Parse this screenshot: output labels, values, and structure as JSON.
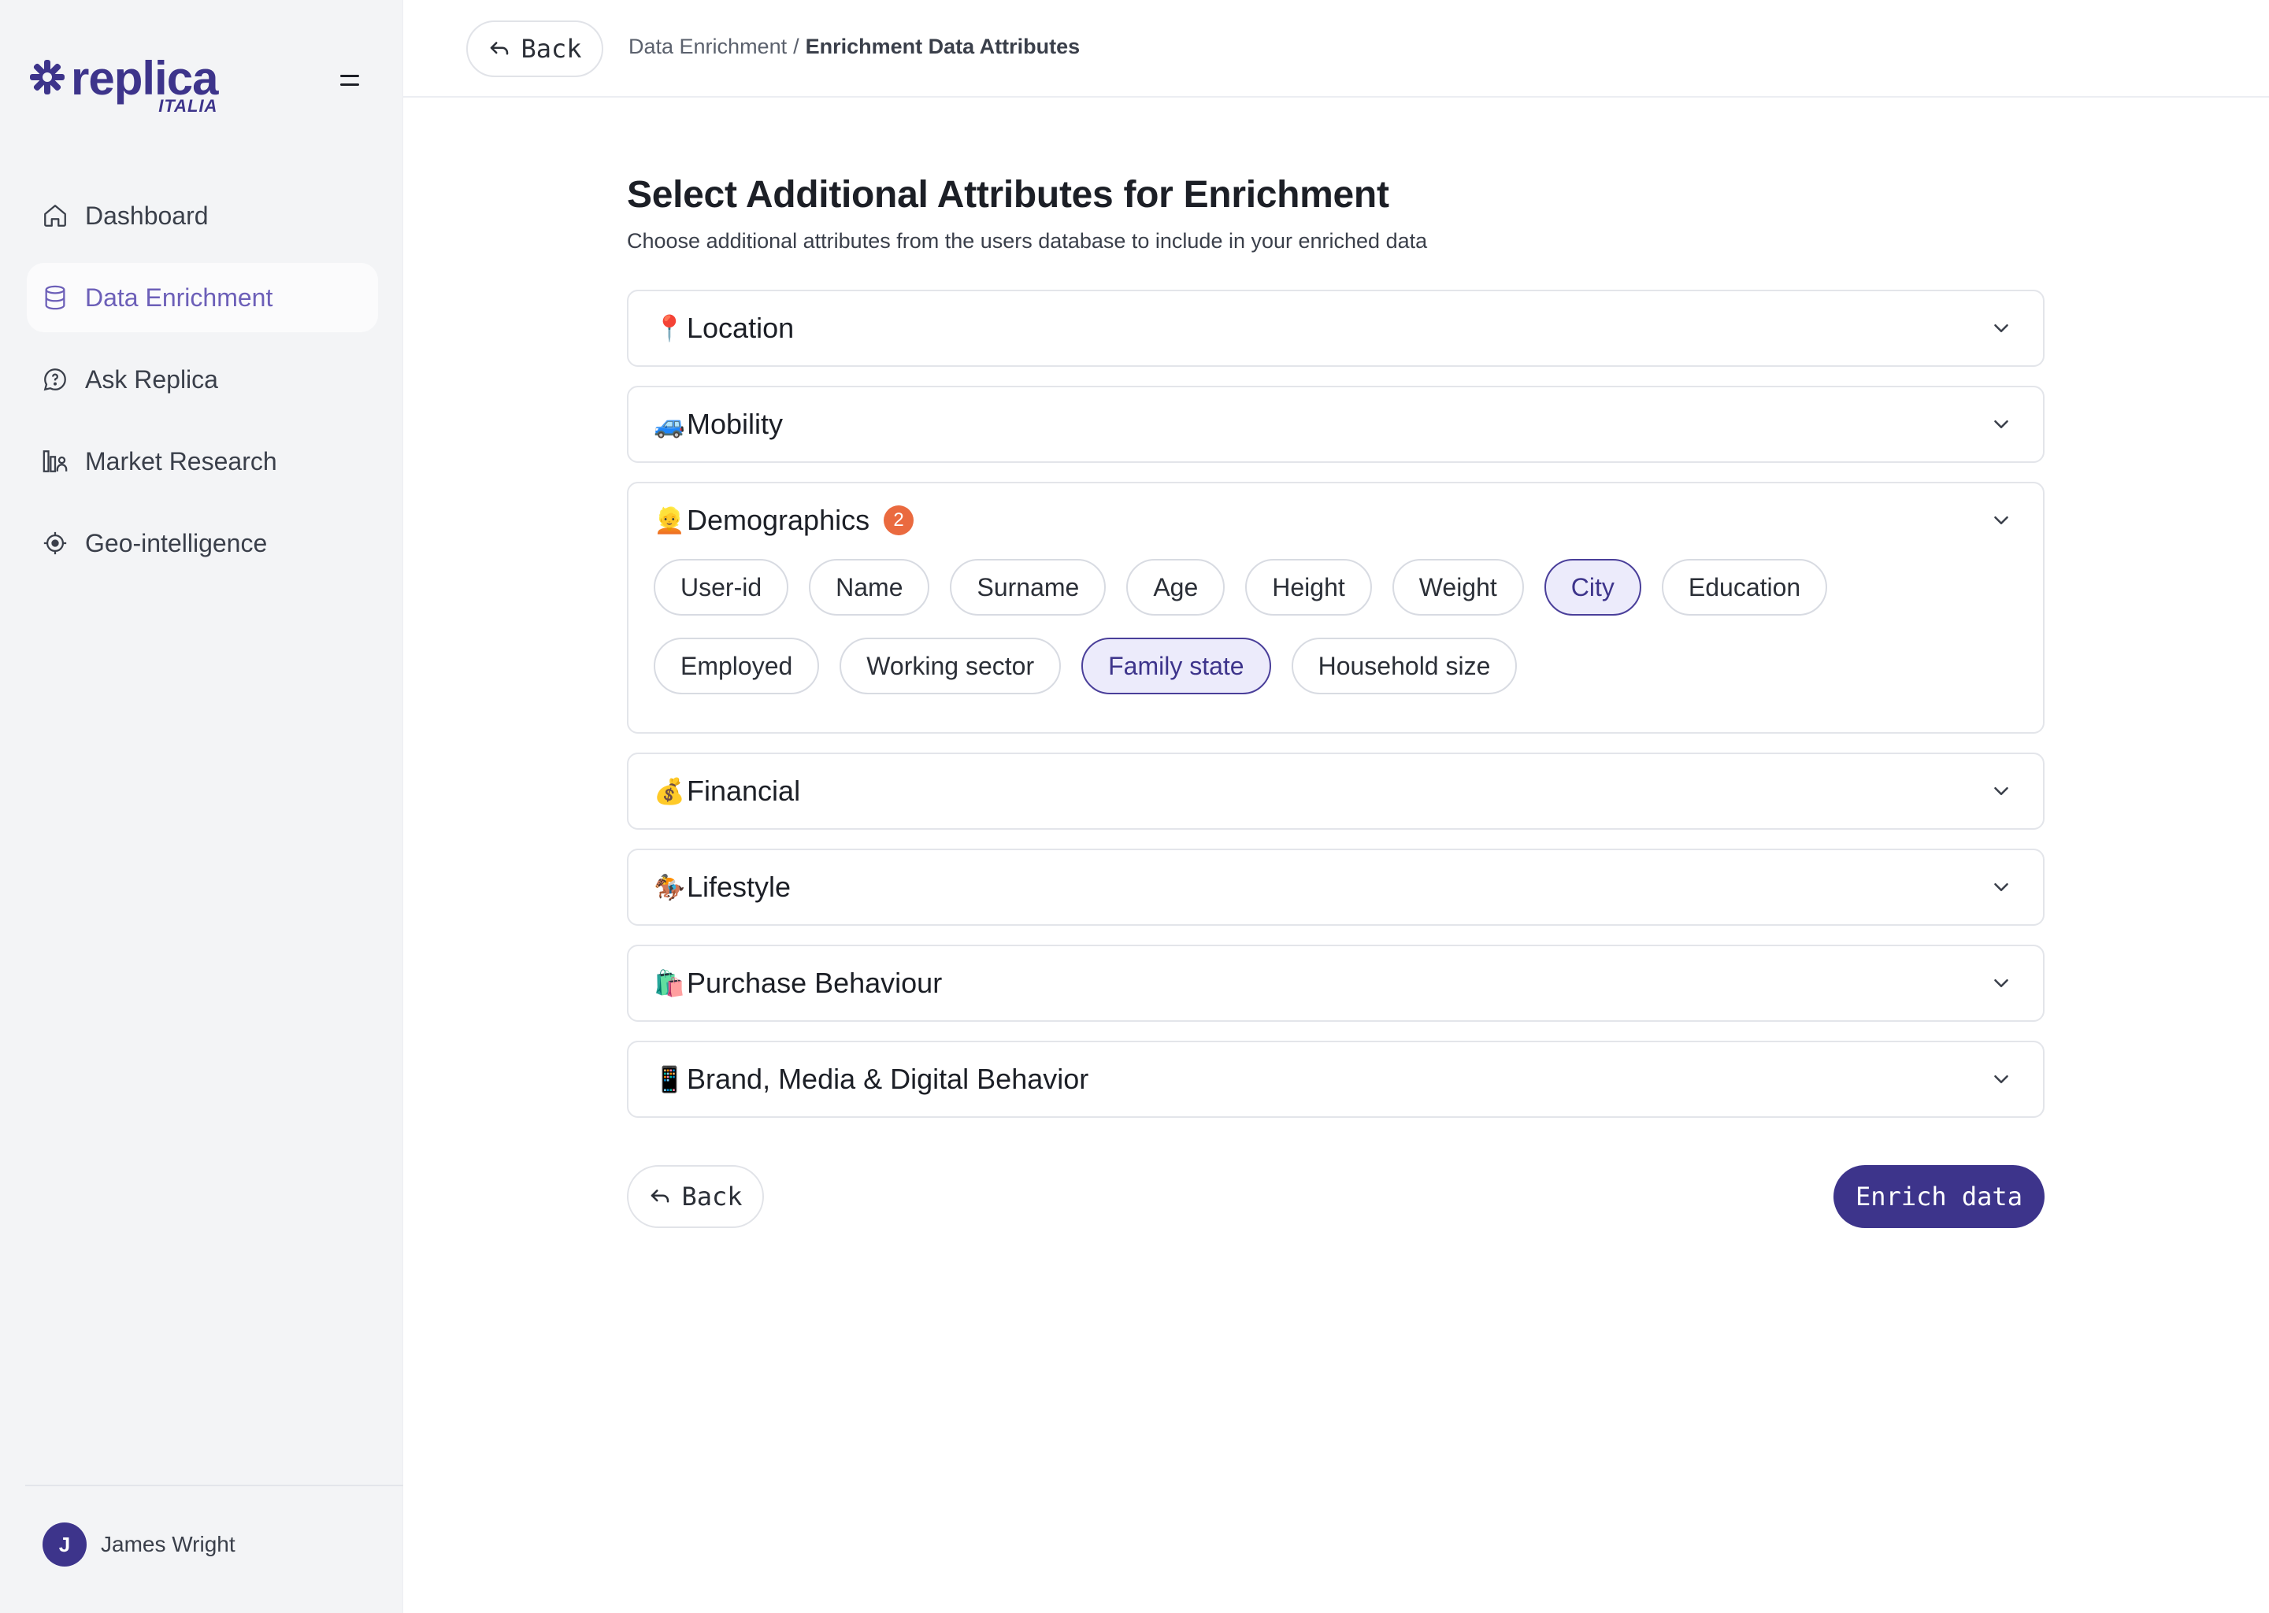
{
  "brand": {
    "name": "replica",
    "sub": "ITALIA",
    "color": "#3d348b"
  },
  "sidebar": {
    "items": [
      {
        "label": "Dashboard",
        "icon": "home-icon",
        "active": false
      },
      {
        "label": "Data Enrichment",
        "icon": "database-icon",
        "active": true
      },
      {
        "label": "Ask Replica",
        "icon": "chat-icon",
        "active": false
      },
      {
        "label": "Market Research",
        "icon": "chart-user-icon",
        "active": false
      },
      {
        "label": "Geo-intelligence",
        "icon": "crosshair-icon",
        "active": false
      }
    ],
    "user": {
      "initial": "J",
      "name": "James Wright"
    }
  },
  "topbar": {
    "back_label": "Back",
    "breadcrumb": {
      "parent": "Data Enrichment",
      "separator": "/",
      "current": "Enrichment Data Attributes"
    }
  },
  "main": {
    "title": "Select Additional Attributes for Enrichment",
    "subtitle": "Choose additional attributes from the users database to include in your enriched data",
    "sections": [
      {
        "emoji": "📍",
        "title": "Location",
        "expanded": false
      },
      {
        "emoji": "🚙",
        "title": "Mobility",
        "expanded": false
      },
      {
        "emoji": "👱",
        "title": "Demographics",
        "expanded": true,
        "badge": "2",
        "chips": [
          {
            "label": "User-id",
            "selected": false
          },
          {
            "label": "Name",
            "selected": false
          },
          {
            "label": "Surname",
            "selected": false
          },
          {
            "label": "Age",
            "selected": false
          },
          {
            "label": "Height",
            "selected": false
          },
          {
            "label": "Weight",
            "selected": false
          },
          {
            "label": "City",
            "selected": true
          },
          {
            "label": "Education",
            "selected": false
          },
          {
            "label": "Employed",
            "selected": false
          },
          {
            "label": "Working sector",
            "selected": false
          },
          {
            "label": "Family state",
            "selected": true
          },
          {
            "label": "Household size",
            "selected": false
          }
        ]
      },
      {
        "emoji": "💰",
        "title": "Financial",
        "expanded": false
      },
      {
        "emoji": "🏇",
        "title": "Lifestyle",
        "expanded": false
      },
      {
        "emoji": "🛍️",
        "title": "Purchase Behaviour",
        "expanded": false
      },
      {
        "emoji": "📱",
        "title": "Brand, Media & Digital Behavior",
        "expanded": false
      }
    ],
    "back_label": "Back",
    "enrich_label": "Enrich data"
  },
  "colors": {
    "accent": "#3d348b",
    "badge": "#ea6a3f",
    "chip_selected_bg": "#ecebfb",
    "active_nav_text": "#6c5fb8"
  }
}
